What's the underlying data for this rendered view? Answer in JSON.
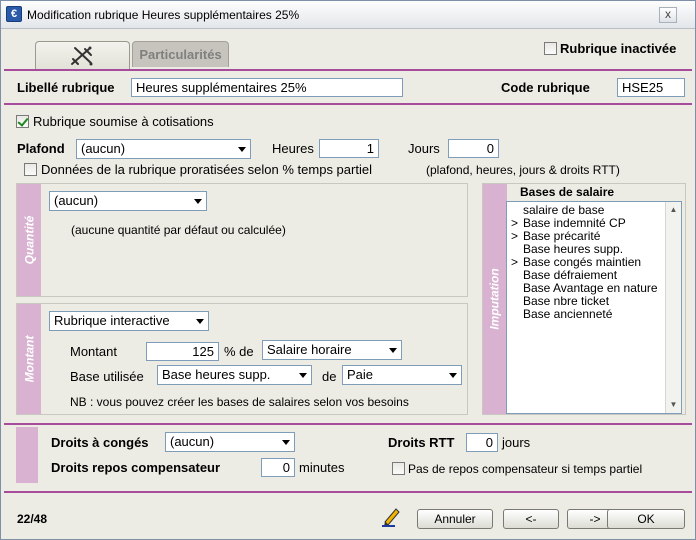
{
  "window": {
    "title": "Modification rubrique Heures supplémentaires 25%",
    "app_icon": "app-icon",
    "close_label": "x"
  },
  "tabs": [
    {
      "icon": "sword-icon"
    },
    {
      "label": "Particularités"
    }
  ],
  "rubrique_inactivee": {
    "label": "Rubrique inactivée",
    "checked": false
  },
  "libelle": {
    "label": "Libellé rubrique",
    "value": "Heures supplémentaires 25%"
  },
  "code": {
    "label": "Code rubrique",
    "value": "HSE25"
  },
  "cotisations": {
    "label": "Rubrique soumise à cotisations",
    "checked": true
  },
  "plafond": {
    "label": "Plafond",
    "value": "(aucun)",
    "heures_label": "Heures",
    "heures_value": "1",
    "jours_label": "Jours",
    "jours_value": "0"
  },
  "proratisees": {
    "label": "Données de la rubrique proratisées selon % temps partiel",
    "note": "(plafond, heures, jours & droits RTT)",
    "checked": false
  },
  "quantite": {
    "side_label": "Quantité",
    "value": "(aucun)",
    "note": "(aucune quantité par défaut ou calculée)"
  },
  "imputation": {
    "side_label": "Imputation",
    "header": "Bases de salaire",
    "items": [
      {
        "mark": "",
        "label": "salaire de base"
      },
      {
        "mark": ">",
        "label": "Base indemnité CP"
      },
      {
        "mark": ">",
        "label": "Base précarité"
      },
      {
        "mark": "",
        "label": "Base heures supp."
      },
      {
        "mark": ">",
        "label": "Base congés maintien"
      },
      {
        "mark": "",
        "label": "Base défraiement"
      },
      {
        "mark": "",
        "label": "Base Avantage en nature"
      },
      {
        "mark": "",
        "label": "Base nbre ticket"
      },
      {
        "mark": "",
        "label": "Base ancienneté"
      }
    ]
  },
  "montant": {
    "side_label": "Montant",
    "type_value": "Rubrique interactive",
    "montant_label": "Montant",
    "montant_value": "125",
    "pct_de_label": "% de",
    "pct_de_value": "Salaire horaire",
    "base_label": "Base utilisée",
    "base_value": "Base heures supp.",
    "de_label": "de",
    "de_value": "Paie",
    "note": "NB : vous pouvez créer les bases de salaires selon vos besoins"
  },
  "droits": {
    "conges_label": "Droits à congés",
    "conges_value": "(aucun)",
    "rtt_label": "Droits RTT",
    "rtt_value": "0",
    "rtt_unit": "jours",
    "repos_label": "Droits repos compensateur",
    "repos_value": "0",
    "repos_unit": "minutes",
    "pas_repos_label": "Pas de repos compensateur si temps partiel",
    "pas_repos_checked": false
  },
  "footer": {
    "counter": "22/48",
    "edit_icon": "pencil-icon",
    "annuler": "Annuler",
    "prev": "<-",
    "next": "->",
    "ok": "OK"
  },
  "colors": {
    "accent": "#a74b9b",
    "side_label_bg": "#d8b2d0",
    "background": "#ecece4"
  }
}
